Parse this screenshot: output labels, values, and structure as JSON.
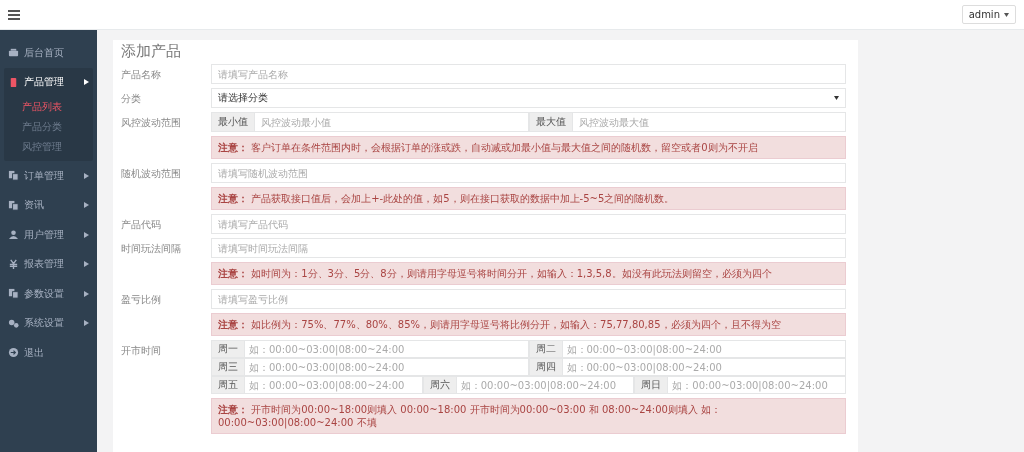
{
  "topbar": {
    "user": "admin"
  },
  "sidebar": {
    "items": [
      {
        "label": "后台首页",
        "expandable": false,
        "expanded": false
      },
      {
        "label": "产品管理",
        "expandable": true,
        "expanded": true,
        "children": [
          {
            "label": "产品列表",
            "selected": true
          },
          {
            "label": "产品分类",
            "selected": false
          },
          {
            "label": "风控管理",
            "selected": false
          }
        ]
      },
      {
        "label": "订单管理",
        "expandable": true,
        "expanded": false
      },
      {
        "label": "资讯",
        "expandable": true,
        "expanded": false
      },
      {
        "label": "用户管理",
        "expandable": true,
        "expanded": false
      },
      {
        "label": "报表管理",
        "expandable": true,
        "expanded": false
      },
      {
        "label": "参数设置",
        "expandable": true,
        "expanded": false
      },
      {
        "label": "系统设置",
        "expandable": true,
        "expanded": false
      },
      {
        "label": "退出",
        "expandable": false,
        "expanded": false
      }
    ]
  },
  "form": {
    "title": "添加产品",
    "rows": [
      {
        "kind": "text",
        "label": "产品名称",
        "placeholder": "请填写产品名称"
      },
      {
        "kind": "select",
        "label": "分类",
        "value": "请选择分类"
      },
      {
        "kind": "range",
        "label": "风控波动范围",
        "min_addon": "最小值",
        "min_placeholder": "风控波动最小值",
        "max_addon": "最大值",
        "max_placeholder": "风控波动最大值"
      },
      {
        "kind": "note",
        "text": "**注意：** 客户订单在条件范围内时，会根据订单的涨或跌，自动减或加最小值与最大值之间的随机数，留空或者0则为不开启"
      },
      {
        "kind": "text",
        "label": "随机波动范围",
        "placeholder": "请填写随机波动范围"
      },
      {
        "kind": "note",
        "text": "**注意：** 产品获取接口值后，会加上+-此处的值，如5，则在接口获取的数据中加上-5~5之间的随机数。"
      },
      {
        "kind": "text",
        "label": "产品代码",
        "placeholder": "请填写产品代码"
      },
      {
        "kind": "text",
        "label": "时间玩法间隔",
        "placeholder": "请填写时间玩法间隔"
      },
      {
        "kind": "note",
        "text": "**注意：** 如时间为：1分、3分、5分、8分，则请用字母逗号将时间分开，如输入：1,3,5,8。如没有此玩法则留空，必须为四个"
      },
      {
        "kind": "text",
        "label": "盈亏比例",
        "placeholder": "请填写盈亏比例"
      },
      {
        "kind": "note",
        "text": "**注意：** 如比例为：75%、77%、80%、85%，则请用字母逗号将比例分开，如输入：75,77,80,85，必须为四个，且不得为空"
      },
      {
        "kind": "schedule",
        "label": "开市时间",
        "lines": [
          [
            {
              "day": "周一",
              "placeholder": "如：00:00~03:00|08:00~24:00"
            },
            {
              "day": "周二",
              "placeholder": "如：00:00~03:00|08:00~24:00"
            }
          ],
          [
            {
              "day": "周三",
              "placeholder": "如：00:00~03:00|08:00~24:00"
            },
            {
              "day": "周四",
              "placeholder": "如：00:00~03:00|08:00~24:00"
            }
          ],
          [
            {
              "day": "周五",
              "placeholder": "如：00:00~03:00|08:00~24:00"
            },
            {
              "day": "周六",
              "placeholder": "如：00:00~03:00|08:00~24:00"
            },
            {
              "day": "周日",
              "placeholder": "如：00:00~03:00|08:00~24:00"
            }
          ]
        ]
      },
      {
        "kind": "note",
        "text": "**注意：** 开市时间为00:00~18:00则填入 00:00~18:00 开市时间为00:00~03:00 和 08:00~24:00则填入 如：00:00~03:00|08:00~24:00 不填"
      }
    ]
  }
}
